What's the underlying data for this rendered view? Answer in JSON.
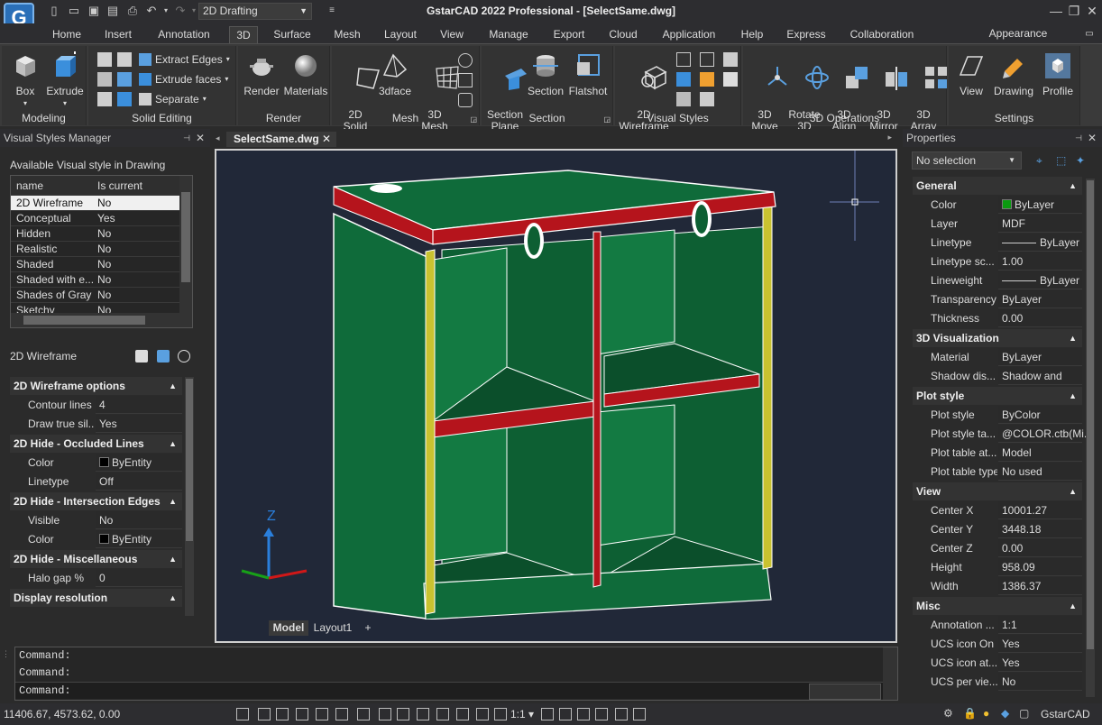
{
  "titlebar": {
    "workspace": "2D Drafting",
    "title": "GstarCAD 2022 Professional - [SelectSame.dwg]"
  },
  "tabs": [
    "Home",
    "Insert",
    "Annotation",
    "3D",
    "Surface",
    "Mesh",
    "Layout",
    "View",
    "Manage",
    "Export",
    "Cloud",
    "Application",
    "Help",
    "Express",
    "Collaboration"
  ],
  "appearance": "Appearance",
  "ribbon": {
    "modeling": {
      "title": "Modeling",
      "box": "Box",
      "extrude": "Extrude"
    },
    "solid_editing": {
      "title": "Solid Editing",
      "extract": "Extract Edges",
      "extrude_faces": "Extrude faces",
      "separate": "Separate"
    },
    "render": {
      "title": "Render",
      "render": "Render",
      "materials": "Materials"
    },
    "mesh": {
      "title": "Mesh",
      "solid2d": "2D\nSolid",
      "face3d": "3dface",
      "mesh3d": "3D\nMesh"
    },
    "section": {
      "title": "Section",
      "plane": "Section\nPlane",
      "section": "Section",
      "flatshot": "Flatshot"
    },
    "visual_styles": {
      "title": "Visual Styles",
      "wire": "2D\nWireframe"
    },
    "ops3d": {
      "title": "3D Operations",
      "move": "3D\nMove",
      "rotate": "Rotate\n3D",
      "align": "3D\nAlign",
      "mirror": "3D\nMirror",
      "array": "3D\nArray"
    },
    "settings": {
      "title": "Settings",
      "view": "View",
      "drawing": "Drawing",
      "profile": "Profile"
    }
  },
  "left": {
    "header": "Visual Styles Manager",
    "available": "Available Visual style in Drawing",
    "col_name": "name",
    "col_current": "Is current Visual...",
    "styles": [
      [
        "2D Wireframe",
        "No"
      ],
      [
        "Conceptual",
        "Yes"
      ],
      [
        "Hidden",
        "No"
      ],
      [
        "Realistic",
        "No"
      ],
      [
        "Shaded",
        "No"
      ],
      [
        "Shaded with e...",
        "No"
      ],
      [
        "Shades of Gray",
        "No"
      ],
      [
        "Sketchy",
        "No"
      ]
    ],
    "selected": "2D Wireframe",
    "groups": [
      {
        "title": "2D Wireframe options",
        "rows": [
          [
            "Contour lines",
            "4"
          ],
          [
            "Draw true sil...",
            "Yes"
          ]
        ]
      },
      {
        "title": "2D Hide - Occluded Lines",
        "rows": [
          [
            "Color",
            "ByEntity"
          ],
          [
            "Linetype",
            "Off"
          ]
        ]
      },
      {
        "title": "2D Hide - Intersection Edges",
        "rows": [
          [
            "Visible",
            "No"
          ],
          [
            "Color",
            "ByEntity"
          ]
        ]
      },
      {
        "title": "2D Hide - Miscellaneous",
        "rows": [
          [
            "Halo gap %",
            "0"
          ]
        ]
      },
      {
        "title": "Display resolution",
        "rows": []
      }
    ]
  },
  "doc": {
    "tab": "SelectSame.dwg",
    "layout_model": "Model",
    "layout1": "Layout1",
    "plus": "+",
    "axis_z": "Z"
  },
  "right": {
    "header": "Properties",
    "selection": "No selection",
    "groups": [
      {
        "title": "General",
        "rows": [
          [
            "Color",
            "ByLayer"
          ],
          [
            "Layer",
            "MDF"
          ],
          [
            "Linetype",
            "ByLayer"
          ],
          [
            "Linetype sc...",
            "1.00"
          ],
          [
            "Lineweight",
            "ByLayer"
          ],
          [
            "Transparency",
            "ByLayer"
          ],
          [
            "Thickness",
            "0.00"
          ]
        ]
      },
      {
        "title": "3D Visualization",
        "rows": [
          [
            "Material",
            "ByLayer"
          ],
          [
            "Shadow dis...",
            "Shadow and rec..."
          ]
        ]
      },
      {
        "title": "Plot style",
        "rows": [
          [
            "Plot style",
            "ByColor"
          ],
          [
            "Plot style ta...",
            "@COLOR.ctb(Mi..."
          ],
          [
            "Plot table at...",
            "Model"
          ],
          [
            "Plot table type",
            "No used"
          ]
        ]
      },
      {
        "title": "View",
        "rows": [
          [
            "Center X",
            "10001.27"
          ],
          [
            "Center Y",
            "3448.18"
          ],
          [
            "Center Z",
            "0.00"
          ],
          [
            "Height",
            "958.09"
          ],
          [
            "Width",
            "1386.37"
          ]
        ]
      },
      {
        "title": "Misc",
        "rows": [
          [
            "Annotation ...",
            "1:1"
          ],
          [
            "UCS icon On",
            "Yes"
          ],
          [
            "UCS icon at...",
            "Yes"
          ],
          [
            "UCS per vie...",
            "No"
          ]
        ]
      }
    ]
  },
  "command": {
    "lines": [
      "Command:",
      "Command:"
    ],
    "prompt": "Command:"
  },
  "status": {
    "coords": "11406.67, 4573.62, 0.00",
    "scale": "1:1",
    "brand": "GstarCAD"
  },
  "colors": {
    "cabinet": "#0f6b3a",
    "edge_red": "#b5141c",
    "edge_yellow": "#c9c230",
    "bg": "#212838"
  }
}
